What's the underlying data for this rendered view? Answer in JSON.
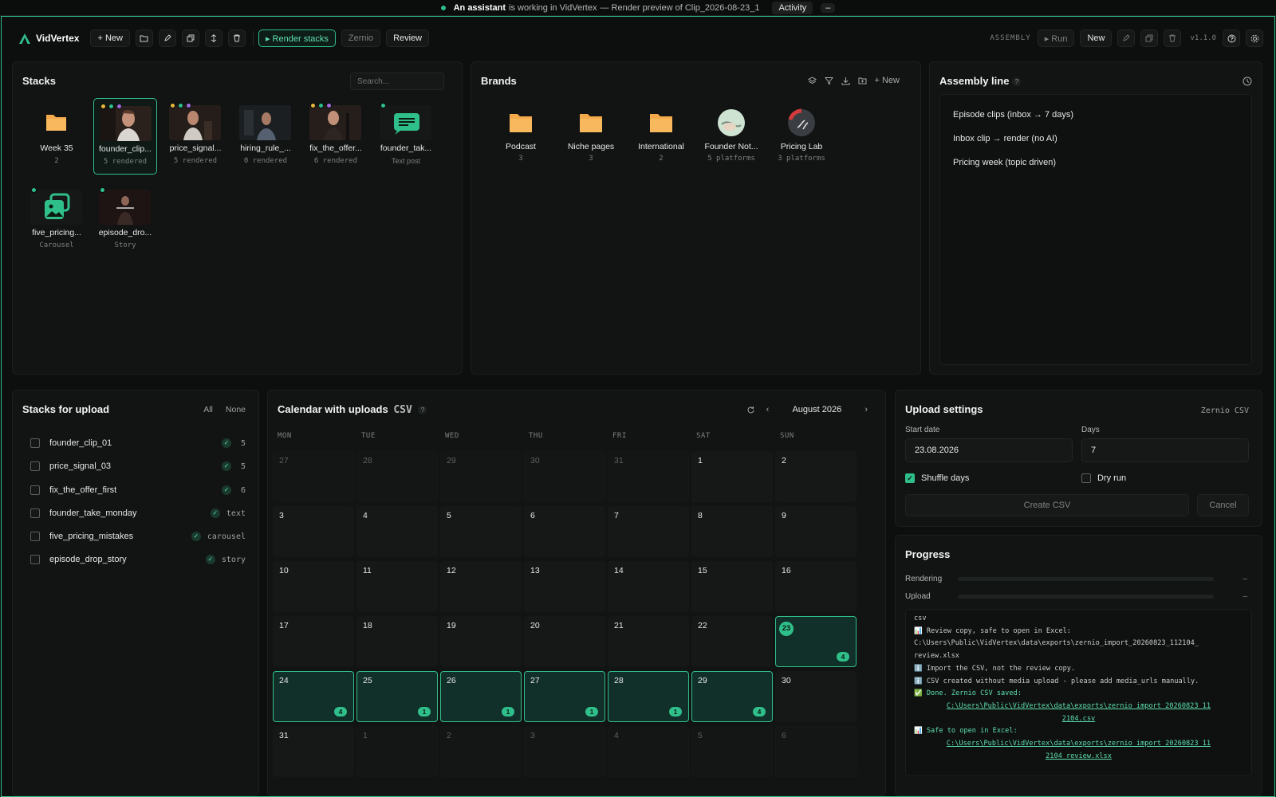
{
  "banner": {
    "agent": "An assistant",
    "middle": "is working in VidVertex",
    "task": "— Render preview of Clip_2026-08-23_1",
    "activity": "Activity",
    "minimize": "–"
  },
  "toolbar": {
    "app_name": "VidVertex",
    "new_label": "+ New",
    "render_label": "▸ Render stacks",
    "zernio_label": "Zernio",
    "review_label": "Review",
    "assembly_label": "ASSEMBLY",
    "run_label": "▸ Run",
    "new2_label": "New",
    "version": "v1.1.0",
    "accent": "#2fbf8a"
  },
  "stacks": {
    "title": "Stacks",
    "search_placeholder": "Search...",
    "items": [
      {
        "name": "Week 35",
        "sub": "2",
        "kind": "folder"
      },
      {
        "name": "founder_clip...",
        "sub": "5 rendered",
        "kind": "video"
      },
      {
        "name": "price_signal...",
        "sub": "5 rendered",
        "kind": "video"
      },
      {
        "name": "hiring_rule_...",
        "sub": "0 rendered",
        "kind": "video"
      },
      {
        "name": "fix_the_offer...",
        "sub": "6 rendered",
        "kind": "video"
      },
      {
        "name": "founder_tak...",
        "sub": "Text post",
        "kind": "text"
      },
      {
        "name": "five_pricing...",
        "sub": "Carousel",
        "kind": "carousel"
      },
      {
        "name": "episode_dro...",
        "sub": "Story",
        "kind": "story"
      }
    ]
  },
  "brands": {
    "title": "Brands",
    "new_label": "+ New",
    "items": [
      {
        "name": "Podcast",
        "sub": "3"
      },
      {
        "name": "Niche pages",
        "sub": "3"
      },
      {
        "name": "International",
        "sub": "2"
      },
      {
        "name": "Founder Not...",
        "sub": "5 platforms"
      },
      {
        "name": "Pricing Lab",
        "sub": "3 platforms"
      }
    ]
  },
  "assembly": {
    "title": "Assembly line",
    "help": "?",
    "items": [
      "Episode clips (inbox → 7 days)",
      "Inbox clip → render (no AI)",
      "Pricing week (topic driven)"
    ]
  },
  "upload_stacks": {
    "title": "Stacks for upload",
    "all": "All",
    "none": "None",
    "items": [
      {
        "name": "founder_clip_01",
        "count": "5"
      },
      {
        "name": "price_signal_03",
        "count": "5"
      },
      {
        "name": "fix_the_offer_first",
        "count": "6"
      },
      {
        "name": "founder_take_monday",
        "count": "text"
      },
      {
        "name": "five_pricing_mistakes",
        "count": "carousel"
      },
      {
        "name": "episode_drop_story",
        "count": "story"
      }
    ]
  },
  "calendar": {
    "title": "Calendar with uploads",
    "tag": "CSV",
    "help": "?",
    "month": "August 2026",
    "prev": "‹",
    "next": "›",
    "days_of_week": [
      "MON",
      "TUE",
      "WED",
      "THU",
      "FRI",
      "SAT",
      "SUN"
    ],
    "cells": [
      {
        "d": "27",
        "out": true
      },
      {
        "d": "28",
        "out": true
      },
      {
        "d": "29",
        "out": true
      },
      {
        "d": "30",
        "out": true
      },
      {
        "d": "31",
        "out": true
      },
      {
        "d": "1"
      },
      {
        "d": "2"
      },
      {
        "d": "3"
      },
      {
        "d": "4"
      },
      {
        "d": "5"
      },
      {
        "d": "6"
      },
      {
        "d": "7"
      },
      {
        "d": "8"
      },
      {
        "d": "9"
      },
      {
        "d": "10"
      },
      {
        "d": "11"
      },
      {
        "d": "12"
      },
      {
        "d": "13"
      },
      {
        "d": "14"
      },
      {
        "d": "15"
      },
      {
        "d": "16"
      },
      {
        "d": "17"
      },
      {
        "d": "18"
      },
      {
        "d": "19"
      },
      {
        "d": "20"
      },
      {
        "d": "21"
      },
      {
        "d": "22"
      },
      {
        "d": "23",
        "uploads": "4",
        "today": true
      },
      {
        "d": "24",
        "uploads": "4"
      },
      {
        "d": "25",
        "uploads": "1"
      },
      {
        "d": "26",
        "uploads": "1"
      },
      {
        "d": "27",
        "uploads": "1"
      },
      {
        "d": "28",
        "uploads": "1"
      },
      {
        "d": "29",
        "uploads": "4"
      },
      {
        "d": "30"
      },
      {
        "d": "31"
      },
      {
        "d": "1",
        "out": true
      },
      {
        "d": "2",
        "out": true
      },
      {
        "d": "3",
        "out": true
      },
      {
        "d": "4",
        "out": true
      },
      {
        "d": "5",
        "out": true
      },
      {
        "d": "6",
        "out": true
      }
    ]
  },
  "settings": {
    "title": "Upload settings",
    "target": "Zernio CSV",
    "start_label": "Start date",
    "start_value": "23.08.2026",
    "days_label": "Days",
    "days_value": "7",
    "shuffle_label": "Shuffle days",
    "shuffle_checked": true,
    "dry_label": "Dry run",
    "dry_checked": false,
    "create_label": "Create CSV",
    "cancel_label": "Cancel"
  },
  "progress": {
    "title": "Progress",
    "rendering_label": "Rendering",
    "rendering_value": "–",
    "rendering_fraction": 0,
    "upload_label": "Upload",
    "upload_value": "–",
    "upload_fraction": 0,
    "log": [
      {
        "text": "csv",
        "cls": ""
      },
      {
        "text": "📊 Review copy, safe to open in Excel:",
        "cls": ""
      },
      {
        "text": "C:\\Users\\Public\\VidVertex\\data\\exports\\zernio_import_20260823_112104_",
        "cls": ""
      },
      {
        "text": "review.xlsx",
        "cls": ""
      },
      {
        "text": "ℹ️ Import the CSV, not the review copy.",
        "cls": ""
      },
      {
        "text": "ℹ️ CSV created without media upload - please add media_urls manually.",
        "cls": ""
      },
      {
        "text": "✅ Done. Zernio CSV saved:",
        "cls": "ok"
      },
      {
        "text": "C:\\Users\\Public\\VidVertex\\data\\exports\\zernio_import_20260823_11",
        "cls": "link"
      },
      {
        "text": "2104.csv",
        "cls": "link"
      },
      {
        "text": "📊 Safe to open in Excel:",
        "cls": "ok"
      },
      {
        "text": "C:\\Users\\Public\\VidVertex\\data\\exports\\zernio_import_20260823_11",
        "cls": "link"
      },
      {
        "text": "2104_review.xlsx",
        "cls": "link"
      }
    ]
  }
}
